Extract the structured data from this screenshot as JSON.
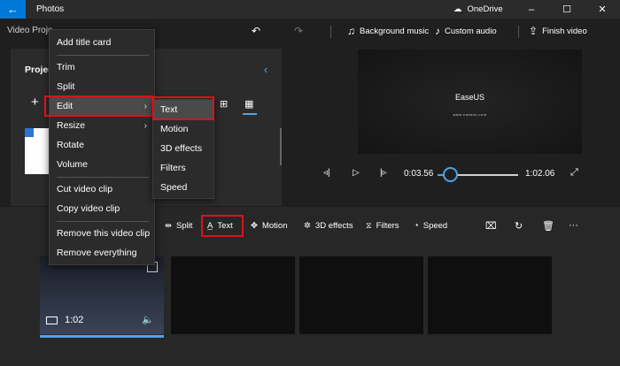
{
  "window": {
    "title": "Photos",
    "back_icon": "back-arrow-icon",
    "onedrive_label": "OneDrive",
    "controls": [
      "–",
      "☐",
      "✕"
    ]
  },
  "cmdbar": {
    "breadcrumb": "Video Proje",
    "undo_icon": "undo-icon",
    "redo_icon": "redo-icon",
    "background_music": "Background music",
    "custom_audio": "Custom audio",
    "finish_video": "Finish video"
  },
  "project": {
    "label": "Projec",
    "add_label": "+"
  },
  "context_menu": {
    "items": [
      {
        "label": "Add title card"
      },
      {
        "label": "Trim"
      },
      {
        "label": "Split"
      },
      {
        "label": "Edit",
        "submenu": true,
        "highlighted": true
      },
      {
        "label": "Resize",
        "submenu": true
      },
      {
        "label": "Rotate"
      },
      {
        "label": "Volume"
      },
      {
        "label": "Cut video clip"
      },
      {
        "label": "Copy video clip"
      },
      {
        "label": "Remove this video clip"
      },
      {
        "label": "Remove everything"
      }
    ]
  },
  "submenu": {
    "items": [
      "Text",
      "Motion",
      "3D effects",
      "Filters",
      "Speed"
    ]
  },
  "preview": {
    "title": "EaseUS",
    "subtitle": "www.easeus.com"
  },
  "playback": {
    "current_time": "0:03.56",
    "total_time": "1:02.06",
    "progress": 0.06
  },
  "storyboard": {
    "split": "Split",
    "text": "Text",
    "motion": "Motion",
    "effects3d": "3D effects",
    "filters": "Filters",
    "speed": "Speed",
    "more": "···"
  },
  "clips": [
    {
      "duration": "1:02",
      "selected": true
    },
    {
      "duration": ""
    },
    {
      "duration": ""
    },
    {
      "duration": ""
    }
  ],
  "colors": {
    "accent": "#0078d7",
    "highlight_red": "#e0101a",
    "seek_blue": "#4ea3e8"
  }
}
